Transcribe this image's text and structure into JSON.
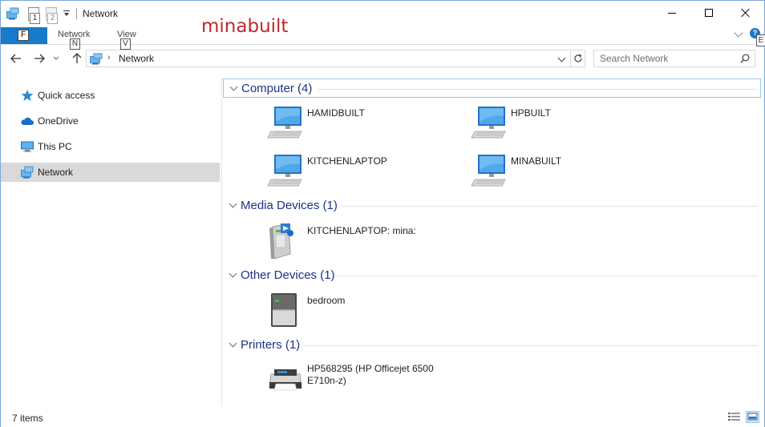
{
  "window": {
    "title": "Network",
    "watermark": "minabuilt"
  },
  "qat": {
    "keytip_1": "1",
    "keytip_2": "2"
  },
  "ribbon": {
    "file_keytip": "F",
    "tabs": [
      {
        "label": "Network",
        "keytip": "N"
      },
      {
        "label": "View",
        "keytip": "V"
      }
    ],
    "help_label": "?",
    "help_keytip": "E"
  },
  "address": {
    "separator": "›",
    "path": "Network"
  },
  "search": {
    "placeholder": "Search Network"
  },
  "nav_pane": {
    "items": [
      {
        "label": "Quick access",
        "icon": "star-icon"
      },
      {
        "label": "OneDrive",
        "icon": "cloud-icon"
      },
      {
        "label": "This PC",
        "icon": "monitor-icon"
      },
      {
        "label": "Network",
        "icon": "network-icon",
        "selected": true
      }
    ]
  },
  "groups": [
    {
      "label": "Computer (4)",
      "items": [
        {
          "name": "HAMIDBUILT",
          "icon": "computer-icon"
        },
        {
          "name": "HPBUILT",
          "icon": "computer-icon"
        },
        {
          "name": "KITCHENLAPTOP",
          "icon": "computer-icon"
        },
        {
          "name": "MINABUILT",
          "icon": "computer-icon"
        }
      ]
    },
    {
      "label": "Media Devices (1)",
      "items": [
        {
          "name": "KITCHENLAPTOP: mina:",
          "icon": "media-server-icon"
        }
      ]
    },
    {
      "label": "Other Devices (1)",
      "items": [
        {
          "name": "bedroom",
          "icon": "device-icon"
        }
      ]
    },
    {
      "label": "Printers (1)",
      "items": [
        {
          "name": "HP568295 (HP Officejet 6500 E710n-z)",
          "icon": "printer-icon"
        }
      ]
    }
  ],
  "status": {
    "item_count": "7 items"
  },
  "colors": {
    "accent": "#1979ca",
    "group_header": "#1e3287",
    "selection": "#d9d9d9",
    "watermark": "#c0282d"
  }
}
